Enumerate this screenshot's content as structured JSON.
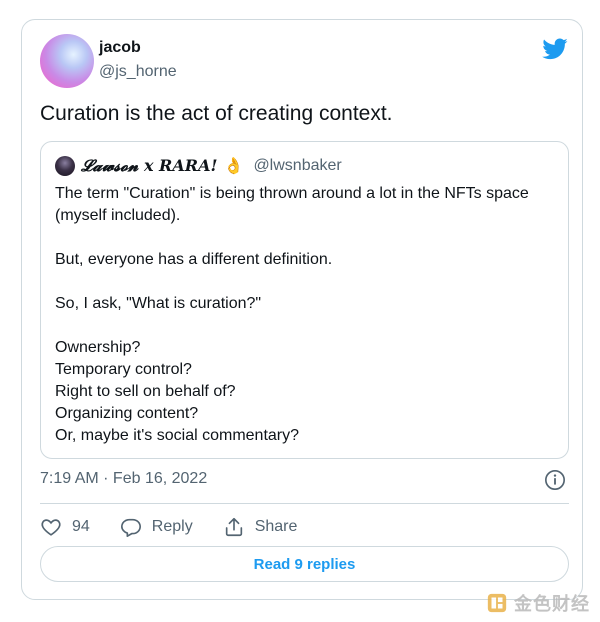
{
  "author": {
    "name": "jacob",
    "handle": "@js_horne"
  },
  "tweet": {
    "text": "Curation is the act of creating context."
  },
  "quote": {
    "name": "𝓛𝓪𝔀𝓼𝓸𝓷 x RARA!",
    "emoji": "👌",
    "handle": "@lwsnbaker",
    "lines": [
      "The term \"Curation\" is being thrown around a lot in the NFTs space",
      "(myself included).",
      "",
      "But, everyone has a different definition.",
      "",
      "So, I ask, \"What is curation?\"",
      "",
      "Ownership?",
      "Temporary control?",
      "Right to sell on behalf of?",
      "Organizing content?",
      "Or, maybe it's social commentary?"
    ]
  },
  "meta": {
    "timestamp": "7:19 AM · Feb 16, 2022"
  },
  "actions": {
    "likes": "94",
    "reply_label": "Reply",
    "share_label": "Share"
  },
  "replies": {
    "label": "Read 9 replies"
  },
  "watermark": {
    "text": "金色财经"
  },
  "colors": {
    "accent": "#1d9bf0",
    "muted": "#536471",
    "border": "#cfd9de"
  },
  "icons": {
    "twitter": "twitter-bird-icon",
    "info": "info-icon",
    "like": "heart-icon",
    "reply": "reply-bubble-icon",
    "share": "share-icon"
  }
}
